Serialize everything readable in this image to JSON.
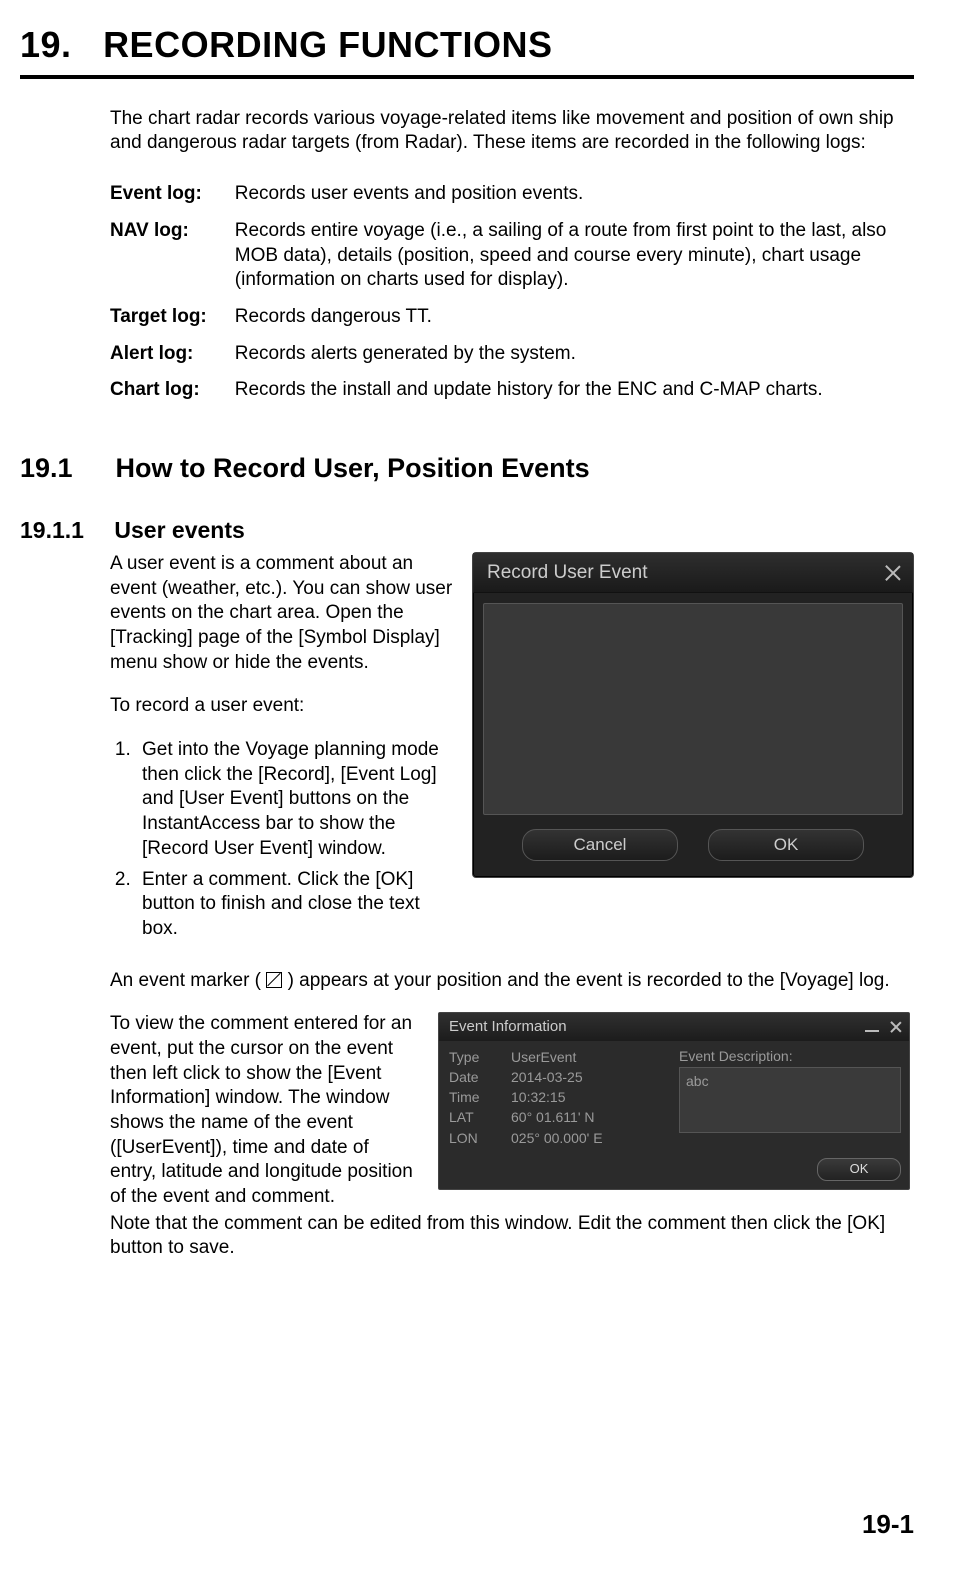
{
  "chapter": {
    "number": "19.",
    "title": "RECORDING FUNCTIONS"
  },
  "intro": "The chart radar records various various voyage-related items like movement and position of own ship and dangerous radar targets (from Radar). These items are recorded in the following logs:",
  "intro_real": "The chart radar records various voyage-related items like movement and position of own ship and dangerous radar targets (from Radar). These items are recorded in the following logs:",
  "logs": [
    {
      "name": "Event log:",
      "desc": "Records user events and position events."
    },
    {
      "name": "NAV log:",
      "desc": "Records entire voyage (i.e., a sailing of a route from first point to the last, also MOB data), details (position, speed and course every minute), chart usage (information on charts used for display)."
    },
    {
      "name": "Target log:",
      "desc": "Records dangerous TT."
    },
    {
      "name": "Alert log:",
      "desc": "Records alerts generated by the system."
    },
    {
      "name": "Chart log:",
      "desc": "Records the install and update history for the ENC and C-MAP charts."
    }
  ],
  "sec1": {
    "num": "19.1",
    "title": "How to Record User, Position Events"
  },
  "sec11": {
    "num": "19.1.1",
    "title": "User events"
  },
  "ue_para": "A user event is a comment about an event (weather, etc.). You can show user events on the chart area. Open the [Tracking] page of the [Symbol Display] menu show or hide the events.",
  "ue_lead": "To record a user event:",
  "ue_steps": [
    "Get into the Voyage planning mode then click the [Record], [Event Log] and [User Event] buttons on the InstantAccess bar to show the [Record User Event] window.",
    "Enter a comment. Click the [OK] button to finish and close the text box."
  ],
  "ue_after1a": "An event marker (",
  "ue_after1b": ") appears at your position and the event is recorded to the [Voyage] log.",
  "ue_after2": "To view the comment entered for an event, put the cursor on the event then left click to show the [Event Information] window. The window shows the name of the event ([UserEvent]), time and date of entry, latitude and longitude position of the event and comment. Note that the comment can be edited from this window. Edit the comment then click the [OK] button to save.",
  "ue_after2_split_head": "To view the comment entered for an event, put the cursor on the event then left click to show the [Event Information] window. The window shows the name of the event ([UserEvent]), time and date of entry, latitude and longitude position of the event and comment.",
  "ue_after2_tail": "Note that the comment can be edited from this window. Edit the comment then click the [OK] button to save.",
  "record_dialog": {
    "title": "Record User Event",
    "cancel": "Cancel",
    "ok": "OK"
  },
  "info_dialog": {
    "title": "Event Information",
    "rows": {
      "type_k": "Type",
      "type_v": "UserEvent",
      "date_k": "Date",
      "date_v": "2014-03-25",
      "time_k": "Time",
      "time_v": "10:32:15",
      "lat_k": "LAT",
      "lat_v": "60° 01.611'  N",
      "lon_k": "LON",
      "lon_v": "025° 00.000'  E"
    },
    "desc_label": "Event Description:",
    "desc_value": "abc",
    "ok": "OK"
  },
  "page_number": "19-1"
}
